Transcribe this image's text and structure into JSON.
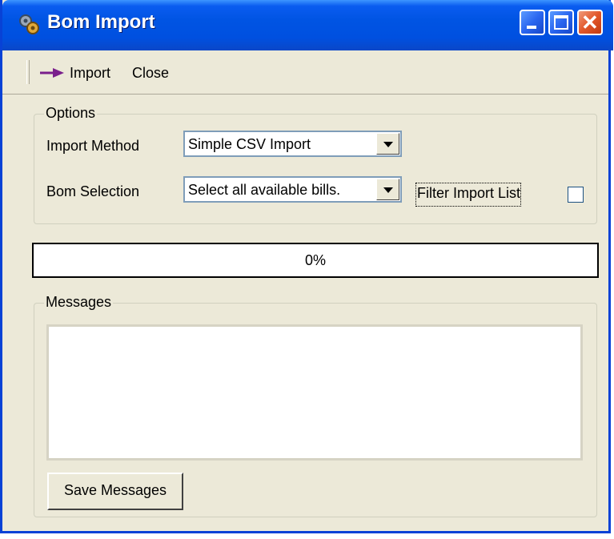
{
  "window": {
    "title": "Bom Import",
    "controls": {
      "minimize": "minimize",
      "maximize": "maximize",
      "close": "close"
    }
  },
  "toolbar": {
    "import_label": "Import",
    "close_label": "Close"
  },
  "options": {
    "legend": "Options",
    "import_method_label": "Import Method",
    "import_method_value": "Simple CSV Import",
    "bom_selection_label": "Bom Selection",
    "bom_selection_value": "Select all available bills.",
    "filter_label": "Filter Import List",
    "filter_checked": false
  },
  "progress": {
    "text": "0%",
    "value": 0
  },
  "messages": {
    "legend": "Messages",
    "content": "",
    "save_label": "Save Messages"
  },
  "colors": {
    "titlebar": "#0054e3",
    "window_bg": "#ece9d8",
    "close_button": "#e2572a",
    "arrow_icon": "#7a1f8c"
  }
}
